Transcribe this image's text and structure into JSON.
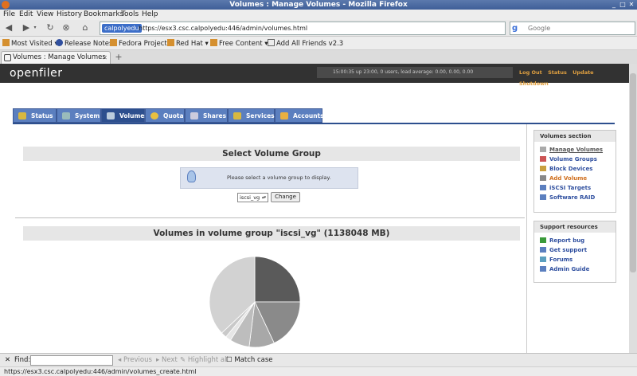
{
  "window": {
    "title": "Volumes : Manage Volumes - Mozilla Firefox"
  },
  "menu": [
    "File",
    "Edit",
    "View",
    "History",
    "Bookmarks",
    "Tools",
    "Help"
  ],
  "address": {
    "site_identity": "calpolyedu",
    "url": "https://esx3.csc.calpolyedu:446/admin/volumes.html"
  },
  "search": {
    "placeholder": "Google"
  },
  "bookmarks": [
    "Most Visited",
    "Release Notes",
    "Fedora Project",
    "Red Hat",
    "Free Content",
    "Add All Friends v2.3"
  ],
  "tab": {
    "label": "Volumes : Manage Volumes"
  },
  "header": {
    "logo": "openfiler",
    "status": "15:00:35 up 23:00, 0 users, load average: 0.00, 0.00, 0.00",
    "links": [
      "Log Out",
      "Status",
      "Update",
      "Shutdown"
    ]
  },
  "nav_tabs": [
    "Status",
    "System",
    "Volumes",
    "Quota",
    "Shares",
    "Services",
    "Accounts"
  ],
  "select_section": {
    "title": "Select Volume Group",
    "info": "Please select a volume group to display.",
    "selected_vg": "iscsi_vg",
    "change_label": "Change"
  },
  "volumes_section": {
    "title": "Volumes in volume group \"iscsi_vg\" (1138048 MB)"
  },
  "sidebar": {
    "volumes_title": "Volumes section",
    "volumes_items": [
      "Manage Volumes",
      "Volume Groups",
      "Block Devices",
      "Add Volume",
      "iSCSI Targets",
      "Software RAID"
    ],
    "support_title": "Support resources",
    "support_items": [
      "Report bug",
      "Get support",
      "Forums",
      "Admin Guide"
    ]
  },
  "findbar": {
    "label": "Find:",
    "previous": "Previous",
    "next": "Next",
    "highlight": "Highlight all",
    "match_case": "Match case"
  },
  "statusbar": {
    "text": "https://esx3.csc.calpolyedu:446/admin/volumes_create.html"
  },
  "colors": {
    "header_bg": "#323232",
    "tab_blue": "#5b7fbf",
    "tab_active": "#2d4f8e",
    "link_blue": "#2f4f9f",
    "header_link": "#e0a040"
  },
  "pie_segments": [
    {
      "value": 25,
      "color": "#5a5a5a"
    },
    {
      "value": 18,
      "color": "#8a8a8a"
    },
    {
      "value": 9,
      "color": "#a8a8a8"
    },
    {
      "value": 7,
      "color": "#bdbdbd"
    },
    {
      "value": 2,
      "color": "#e6e6e6"
    },
    {
      "value": 2,
      "color": "#c9c9c9"
    },
    {
      "value": 37,
      "color": "#d2d2d2"
    }
  ]
}
